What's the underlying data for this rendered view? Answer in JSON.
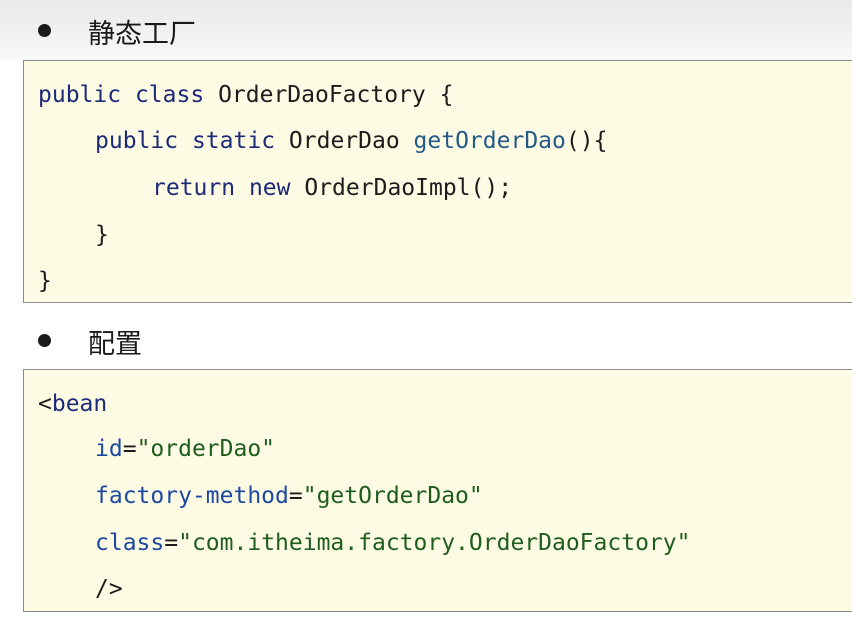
{
  "section1": {
    "title": "静态工厂",
    "code": {
      "line1": {
        "kw1": "public",
        "kw2": "class",
        "name": "OrderDaoFactory",
        "brace": "{"
      },
      "line2": {
        "kw1": "public",
        "kw2": "static",
        "type": "OrderDao",
        "method": "getOrderDao",
        "rest": "(){"
      },
      "line3": {
        "kw1": "return",
        "kw2": "new",
        "rest": "OrderDaoImpl();"
      },
      "line4": "}",
      "line5": "}"
    }
  },
  "section2": {
    "title": "配置",
    "code": {
      "line1": {
        "open": "<",
        "tag": "bean"
      },
      "line2": {
        "attr": "id",
        "eq": "=",
        "value": "\"orderDao\""
      },
      "line3": {
        "attr": "factory-method",
        "eq": "=",
        "value": "\"getOrderDao\""
      },
      "line4": {
        "attr": "class",
        "eq": "=",
        "value": "\"com.itheima.factory.OrderDaoFactory\""
      },
      "line5": "/>"
    }
  },
  "colors": {
    "keyword": "#1c2a78",
    "method": "#245a8a",
    "attribute": "#1d4aa0",
    "string": "#1f5d1f",
    "code_background": "#fdfbe4"
  }
}
